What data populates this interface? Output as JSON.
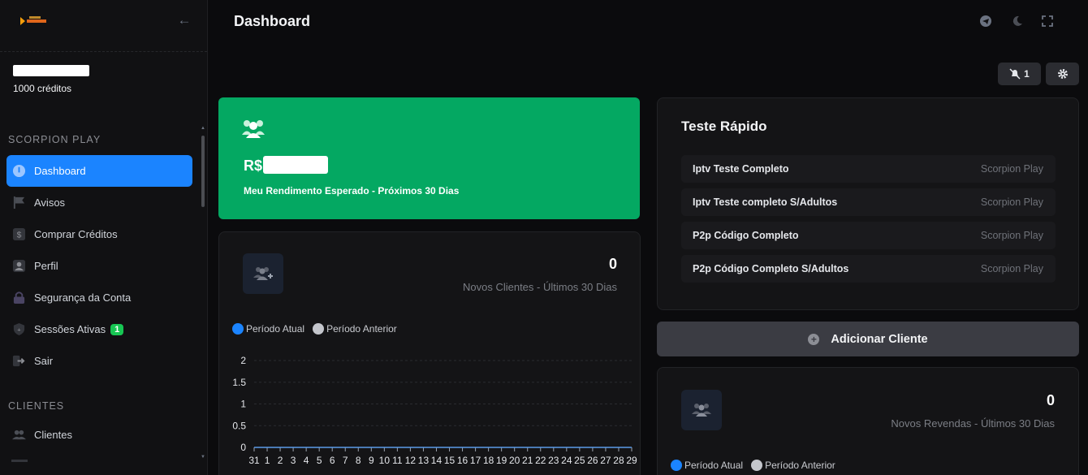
{
  "sidebar": {
    "credits": "1000 créditos",
    "section_main": "SCORPION PLAY",
    "items": [
      {
        "label": "Dashboard",
        "icon": "dashboard-gauge-icon"
      },
      {
        "label": "Avisos",
        "icon": "flag-icon"
      },
      {
        "label": "Comprar Créditos",
        "icon": "dollar-icon"
      },
      {
        "label": "Perfil",
        "icon": "user-icon"
      },
      {
        "label": "Segurança da Conta",
        "icon": "lock-icon"
      },
      {
        "label": "Sessões Ativas",
        "icon": "shield-icon",
        "badge": "1"
      },
      {
        "label": "Sair",
        "icon": "logout-icon"
      }
    ],
    "section_clients": "CLIENTES",
    "client_items": [
      {
        "label": "Clientes",
        "icon": "users-icon"
      }
    ]
  },
  "header": {
    "title": "Dashboard"
  },
  "toolbar": {
    "notifications_count": "1"
  },
  "income_card": {
    "amount_prefix": "R$",
    "label": "Meu Rendimento Esperado - Próximos 30 Dias",
    "color": "#04a862"
  },
  "new_clients": {
    "value": "0",
    "label": "Novos Clientes - Últimos 30 Dias",
    "legend_current": "Período Atual",
    "legend_previous": "Período Anterior"
  },
  "quick_test": {
    "title": "Teste Rápido",
    "rows": [
      {
        "name": "Iptv Teste Completo",
        "provider": "Scorpion Play"
      },
      {
        "name": "Iptv Teste completo S/Adultos",
        "provider": "Scorpion Play"
      },
      {
        "name": "P2p Código Completo",
        "provider": "Scorpion Play"
      },
      {
        "name": "P2p Código Completo S/Adultos",
        "provider": "Scorpion Play"
      }
    ]
  },
  "add_client": {
    "label": "Adicionar Cliente"
  },
  "new_resellers": {
    "value": "0",
    "label": "Novos Revendas - Últimos 30 Dias",
    "legend_current": "Período Atual",
    "legend_previous": "Período Anterior"
  },
  "chart_data": {
    "type": "line",
    "title": "",
    "categories": [
      "31",
      "1",
      "2",
      "3",
      "4",
      "5",
      "6",
      "7",
      "8",
      "9",
      "10",
      "11",
      "12",
      "13",
      "14",
      "15",
      "16",
      "17",
      "18",
      "19",
      "20",
      "21",
      "22",
      "23",
      "24",
      "25",
      "26",
      "27",
      "28",
      "29"
    ],
    "series": [
      {
        "name": "Período Atual",
        "values": [
          0,
          0,
          0,
          0,
          0,
          0,
          0,
          0,
          0,
          0,
          0,
          0,
          0,
          0,
          0,
          0,
          0,
          0,
          0,
          0,
          0,
          0,
          0,
          0,
          0,
          0,
          0,
          0,
          0,
          0
        ],
        "color": "#1b84ff"
      },
      {
        "name": "Período Anterior",
        "values": [
          0,
          0,
          0,
          0,
          0,
          0,
          0,
          0,
          0,
          0,
          0,
          0,
          0,
          0,
          0,
          0,
          0,
          0,
          0,
          0,
          0,
          0,
          0,
          0,
          0,
          0,
          0,
          0,
          0,
          0
        ],
        "color": "#c4c6cc"
      }
    ],
    "yticks": [
      "0",
      "0.5",
      "1",
      "1.5",
      "2"
    ],
    "ylim": [
      0,
      2
    ],
    "grid": true
  }
}
